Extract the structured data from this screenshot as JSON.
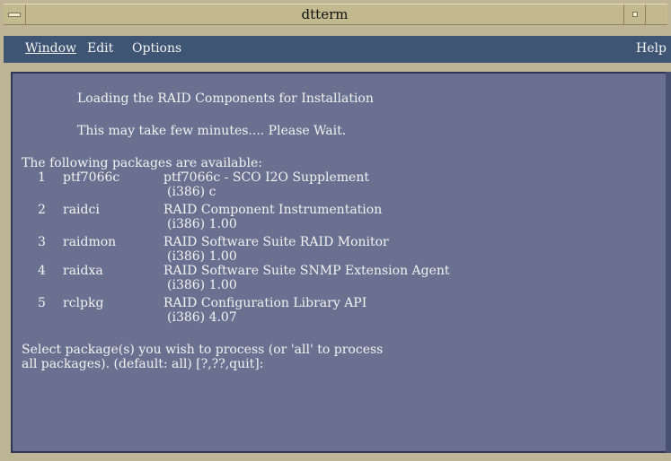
{
  "window": {
    "title": "dtterm"
  },
  "menubar": {
    "window_label": "Window",
    "edit_label": "Edit",
    "options_label": "Options",
    "help_label": "Help"
  },
  "terminal": {
    "loading": "Loading the RAID Components for Installation",
    "wait": "This may take few minutes.... Please Wait.",
    "header": "The following packages are available:",
    "packages": [
      {
        "num": "1",
        "name": "ptf7066c",
        "desc": "ptf7066c - SCO I2O Supplement",
        "version": "(i386) c"
      },
      {
        "num": "2",
        "name": "raidci",
        "desc": "RAID Component Instrumentation",
        "version": "(i386) 1.00"
      },
      {
        "num": "3",
        "name": "raidmon",
        "desc": "RAID Software Suite RAID Monitor",
        "version": "(i386) 1.00"
      },
      {
        "num": "4",
        "name": "raidxa",
        "desc": "RAID Software Suite SNMP Extension Agent",
        "version": "(i386) 1.00"
      },
      {
        "num": "5",
        "name": "rclpkg",
        "desc": "RAID Configuration Library API",
        "version": "(i386) 4.07"
      }
    ],
    "prompt_line1": "Select package(s) you wish to process (or 'all' to process",
    "prompt_line2": "all packages). (default: all) [?,??,quit]:"
  },
  "icons": {
    "window_menu": "window-menu-icon",
    "minimize": "minimize-icon",
    "maximize": "maximize-icon"
  },
  "colors": {
    "menubar_bg": "#3e5573",
    "terminal_bg": "#6a7190",
    "terminal_text": "#f2f2f2"
  }
}
